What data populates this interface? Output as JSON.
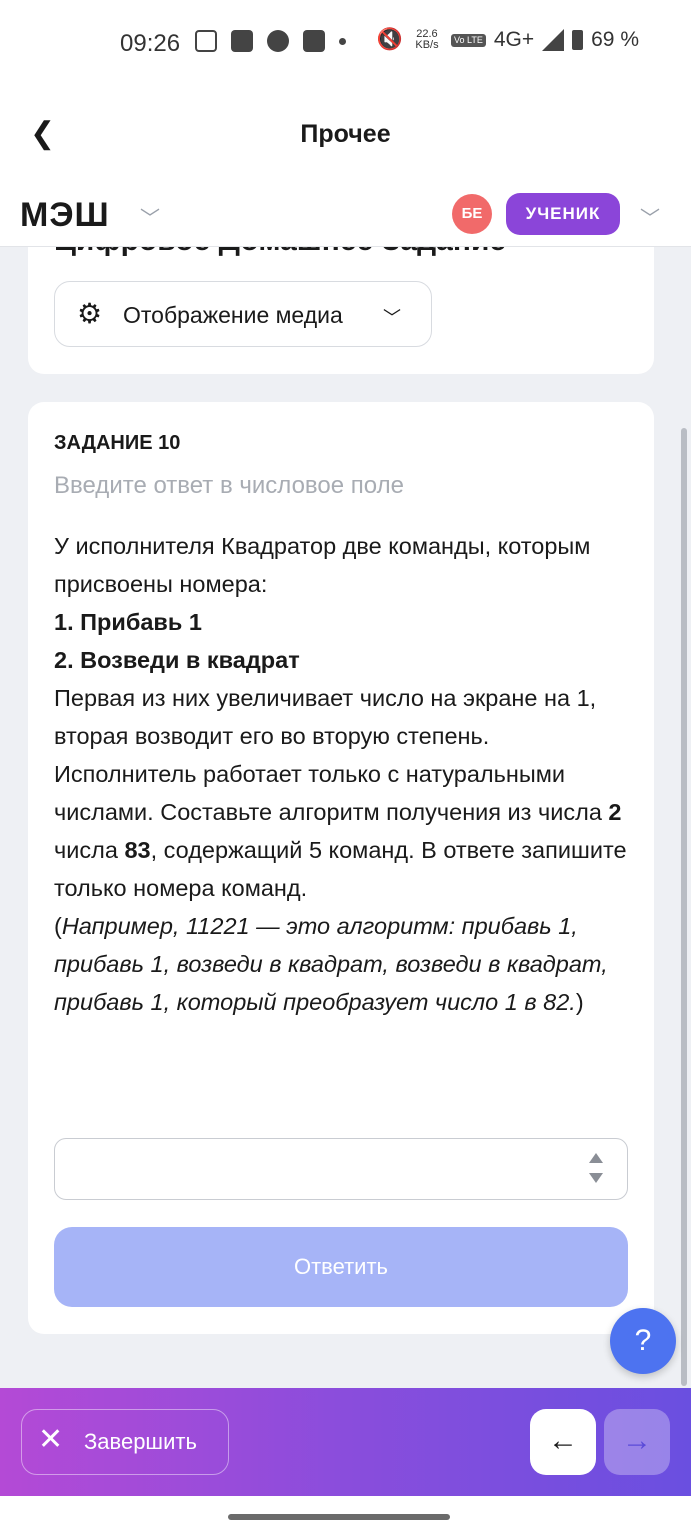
{
  "status_bar": {
    "time": "09:26",
    "speed_value": "22.6",
    "speed_unit": "KB/s",
    "volte": "Vo LTE",
    "network": "4G+",
    "battery": "69 %"
  },
  "top_bar": {
    "back_icon": "chevron-left-icon",
    "title": "Прочее"
  },
  "app_bar": {
    "logo": "МЭШ",
    "avatar_initials": "БЕ",
    "role": "УЧЕНИК"
  },
  "header_card": {
    "title": "Цифровое Домашнее Задание",
    "media_button_label": "Отображение медиа"
  },
  "task": {
    "number": "ЗАДАНИЕ 10",
    "hint": "Введите ответ в числовое поле",
    "intro": "У исполнителя Квадратор две команды, которым присвоены номера:",
    "command_1": "1. Прибавь 1",
    "command_2": "2. Возведи в квадрат",
    "body_1": "Первая из них увеличивает число на экране на 1, вторая возводит его во вторую степень. Исполнитель работает только с натуральными числами. Составьте алгоритм получения из числа ",
    "num_from": "2",
    "body_2": " числа ",
    "num_to": "83",
    "body_3": ", содержащий 5 команд. В ответе запишите только номера команд.",
    "paren_open": "(",
    "example": "Например, 11221 — это алгоритм: прибавь 1, прибавь 1, возведи в квадрат, возведи в квадрат, прибавь 1, который преобразует число 1 в 82.",
    "paren_close": ")",
    "answer_value": "",
    "submit_label": "Ответить"
  },
  "help_label": "?",
  "bottom_bar": {
    "finish_label": "Завершить",
    "prev_icon": "arrow-left-icon",
    "next_icon": "arrow-right-icon"
  },
  "colors": {
    "accent": "#8b45d9",
    "submit_disabled": "#a6b4f7",
    "help": "#4d73f0",
    "avatar": "#f16a6a"
  }
}
